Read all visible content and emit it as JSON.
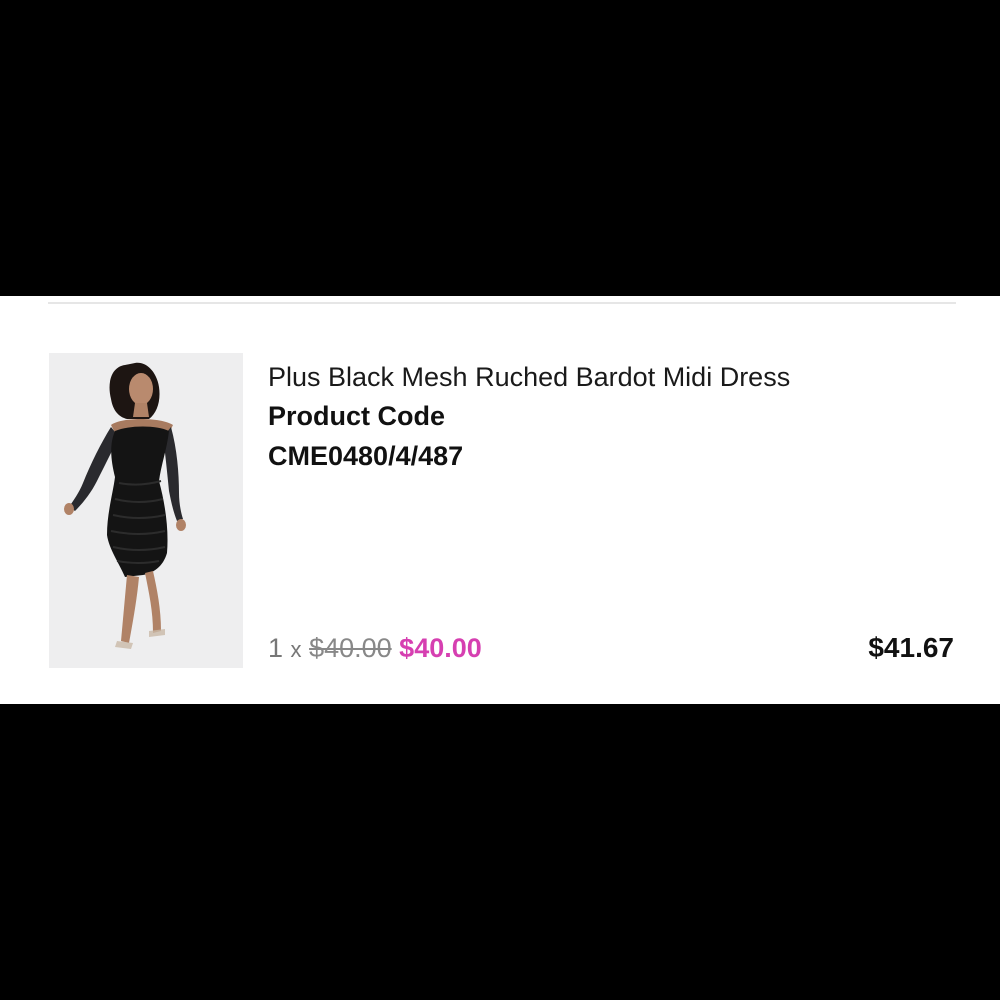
{
  "colors": {
    "background": "#000000",
    "panel": "#ffffff",
    "sale_price": "#d63fb1",
    "strikethrough_price": "#888888",
    "text": "#111111"
  },
  "item": {
    "image_icon": "product-photo",
    "name": "Plus Black Mesh Ruched Bardot Midi Dress",
    "code_label": "Product Code",
    "code_value": "CME0480/4/487",
    "quantity": "1",
    "times": "x",
    "original_price": "$40.00",
    "sale_price": "$40.00",
    "total": "$41.67"
  }
}
